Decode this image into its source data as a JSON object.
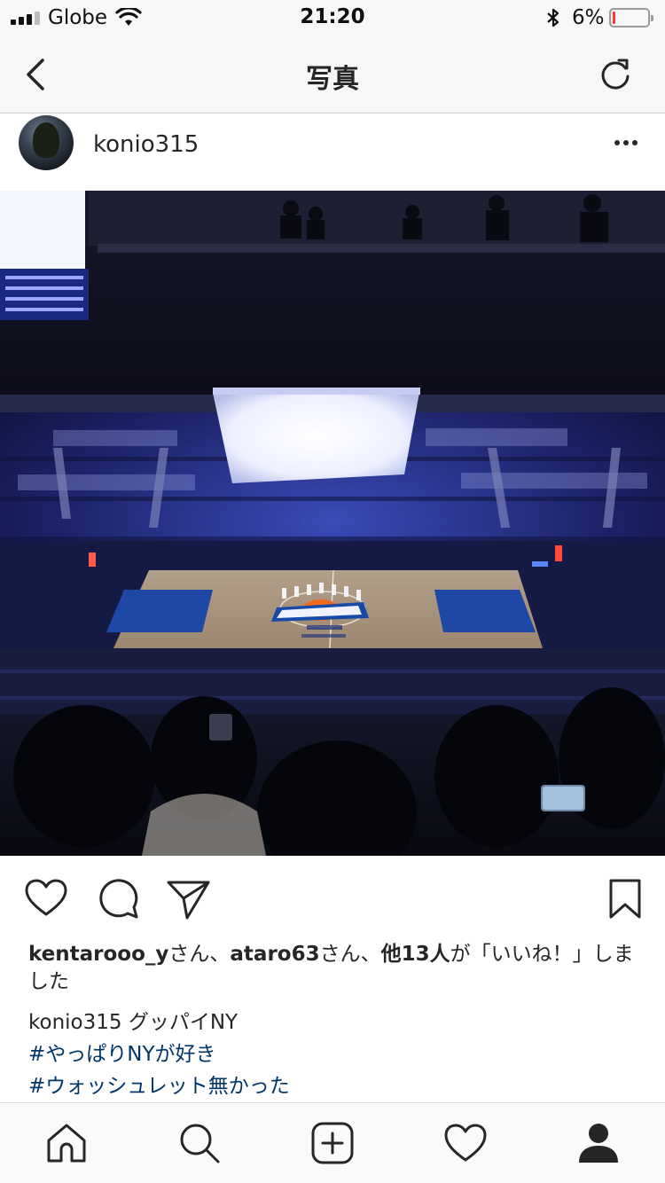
{
  "status_bar": {
    "carrier": "Globe",
    "time": "21:20",
    "battery_percent_label": "6%",
    "battery_level": 0.06,
    "battery_color": "#ff3b30"
  },
  "nav": {
    "title": "写真",
    "back_icon": "chevron-left-icon",
    "refresh_icon": "refresh-icon"
  },
  "post": {
    "username": "konio315",
    "more_icon": "ellipsis-icon",
    "photo_alt": "Madison Square Garden arena view",
    "actions": {
      "like_icon": "heart-icon",
      "comment_icon": "comment-icon",
      "share_icon": "send-icon",
      "save_icon": "bookmark-icon"
    },
    "likes": {
      "user1": "kentarooo_y",
      "sep1": "さん、",
      "user2": "ataro63",
      "sep2": "さん、",
      "others": "他13人",
      "suffix": "が「いいね！」しました"
    },
    "caption": {
      "username": "konio315",
      "text": " グッパイNY",
      "hashtags": [
        "#やっぱりNYが好き",
        "#ウォッシュレット無かった"
      ]
    },
    "link_color": "#003569"
  },
  "tab_bar": {
    "items": [
      "home-icon",
      "search-icon",
      "new-post-icon",
      "activity-icon",
      "profile-icon"
    ]
  }
}
